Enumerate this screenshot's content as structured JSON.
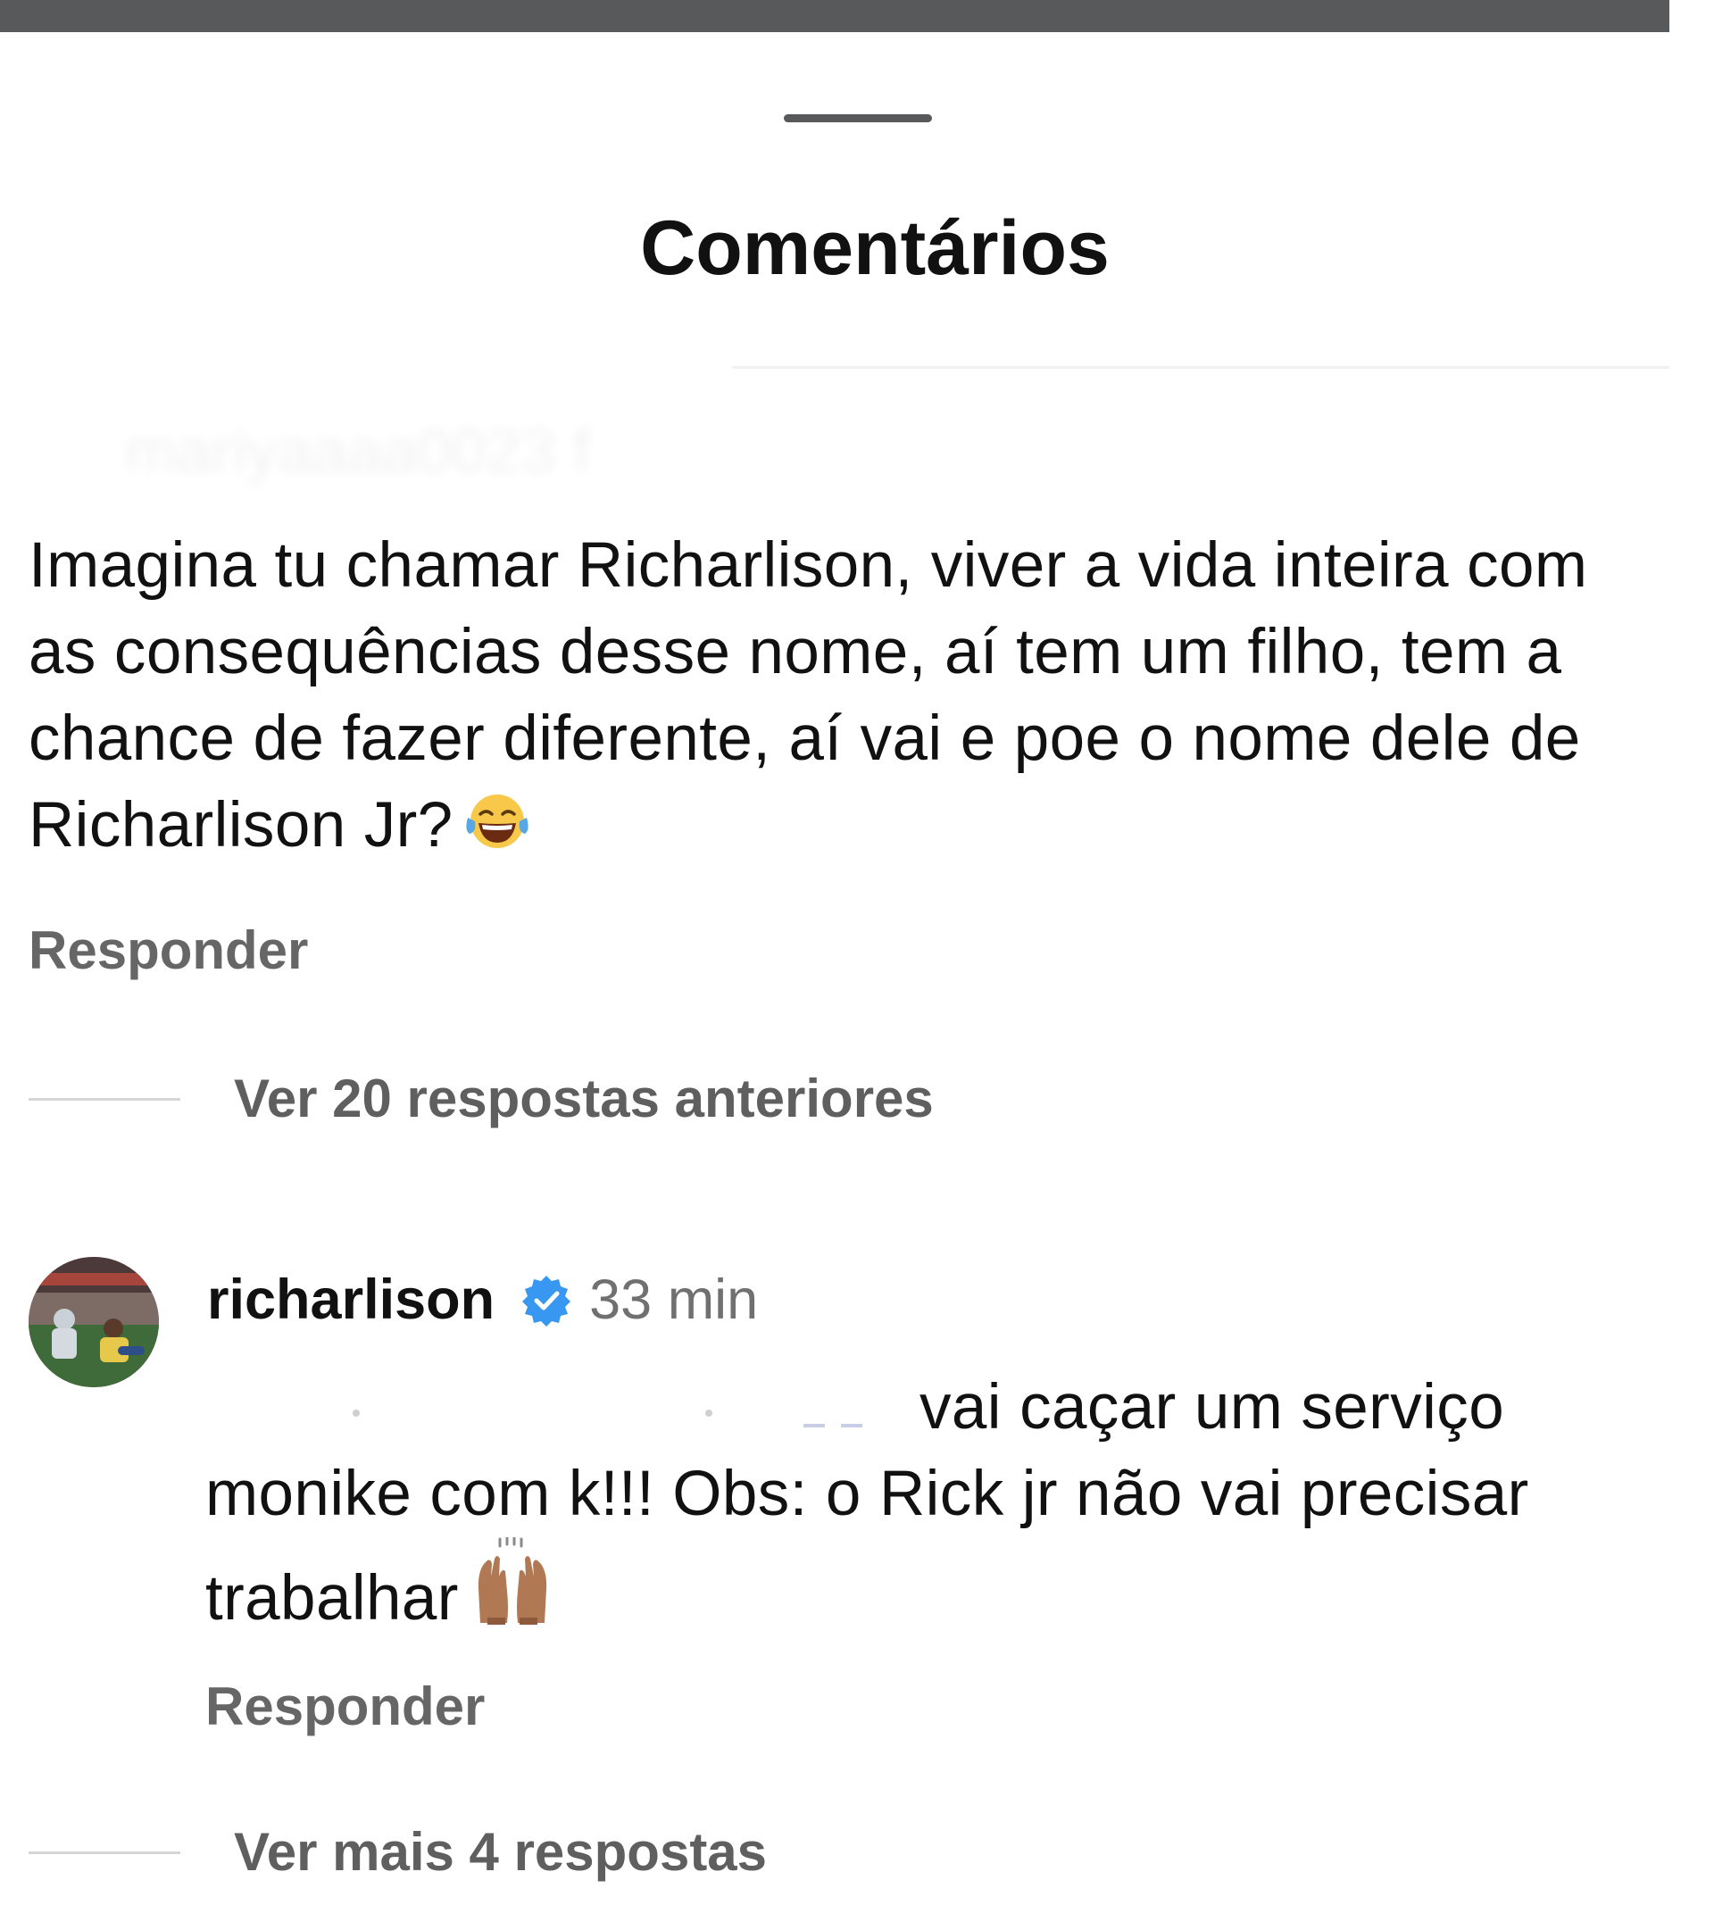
{
  "sheet": {
    "title": "Comentários"
  },
  "comment": {
    "username_obscured": "mariyaaaa0023 f",
    "text": "Imagina tu chamar Richarlison, viver a vida inteira com as consequências desse nome, aí tem um filho, tem a chance de fazer diferente, aí vai e poe o nome dele de Richarlison Jr?",
    "emoji": "tears-of-joy-emoji",
    "reply_label": "Responder",
    "view_previous_label": "Ver 20 respostas anteriores"
  },
  "reply": {
    "username": "richarlison",
    "time": "33 min",
    "verified_icon": "verified-badge-icon",
    "text": "vai caçar um serviço monike com k!!! Obs: o Rick jr não vai precisar trabalhar",
    "emoji": "raising-hands-emoji",
    "reply_label": "Responder",
    "view_more_label": "Ver mais 4 respostas"
  },
  "colors": {
    "verified_blue": "#3897f0",
    "secondary_text": "#666666",
    "top_bar": "#58595b"
  }
}
